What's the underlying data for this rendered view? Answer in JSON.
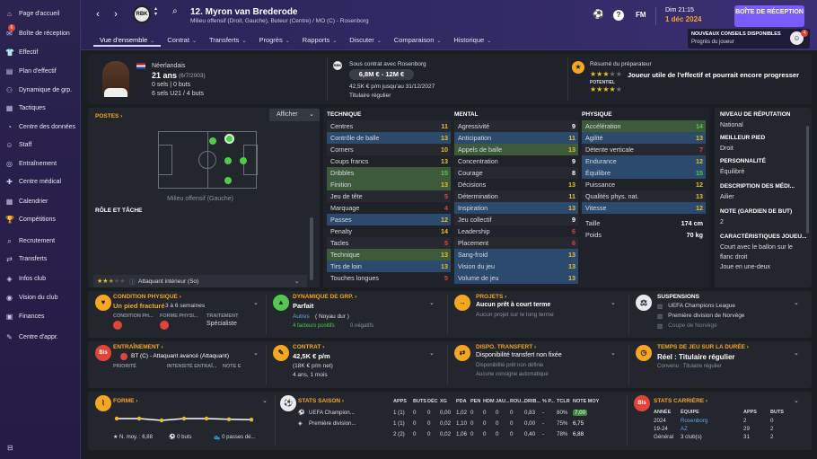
{
  "sidebar": {
    "items": [
      {
        "label": "Page d'accueil",
        "icon": "home-icon",
        "glyph": "⌂"
      },
      {
        "label": "Boîte de réception",
        "icon": "inbox-icon",
        "glyph": "✉",
        "badge": "6"
      },
      {
        "label": "Effectif",
        "icon": "squad-icon",
        "glyph": "👕"
      },
      {
        "label": "Plan d'effectif",
        "icon": "plan-icon",
        "glyph": "▤"
      },
      {
        "label": "Dynamique de grp.",
        "icon": "dynamics-icon",
        "glyph": "⚇"
      },
      {
        "label": "Tactiques",
        "icon": "tactics-icon",
        "glyph": "▦"
      },
      {
        "label": "Centre des données",
        "icon": "data-icon",
        "glyph": "◔"
      },
      {
        "label": "Staff",
        "icon": "staff-icon",
        "glyph": "☺"
      },
      {
        "label": "Entraînement",
        "icon": "training-icon",
        "glyph": "◎"
      },
      {
        "label": "Centre médical",
        "icon": "medical-icon",
        "glyph": "✚"
      },
      {
        "label": "Calendrier",
        "icon": "calendar-icon",
        "glyph": "▦"
      },
      {
        "label": "Compétitions",
        "icon": "trophy-icon",
        "glyph": "🏆"
      },
      {
        "label": "Recrutement",
        "icon": "scouting-icon",
        "glyph": "⌕"
      },
      {
        "label": "Transferts",
        "icon": "transfers-icon",
        "glyph": "⇄"
      },
      {
        "label": "Infos club",
        "icon": "club-info-icon",
        "glyph": "◈"
      },
      {
        "label": "Vision du club",
        "icon": "vision-icon",
        "glyph": "◉"
      },
      {
        "label": "Finances",
        "icon": "finances-icon",
        "glyph": "▣"
      },
      {
        "label": "Centre d'appr.",
        "icon": "learning-icon",
        "glyph": "✎"
      }
    ]
  },
  "header": {
    "player_number_name": "12. Myron van Brederode",
    "position_line": "Milieu offensif (Droit, Gauche), Buteur (Centre) / MO (C) - Rosenborg",
    "time": "Dim 21:15",
    "date": "1 déc 2024",
    "continue_label": "BOÎTE DE RÉCEPTION",
    "fm_label": "FM",
    "news_title": "NOUVEAUX CONSEILS DISPONIBLES",
    "news_sub": "Progrès du joueur",
    "news_badge": "4",
    "club_badge": "RBK"
  },
  "tabs": [
    {
      "label": "Vue d'ensemble",
      "active": true
    },
    {
      "label": "Contrat"
    },
    {
      "label": "Transferts"
    },
    {
      "label": "Progrès"
    },
    {
      "label": "Rapports"
    },
    {
      "label": "Discuter"
    },
    {
      "label": "Comparaison"
    },
    {
      "label": "Historique"
    }
  ],
  "info": {
    "nationality": "Néerlandais",
    "age": "21 ans",
    "birth": "(6/7/2003)",
    "caps": "0 sels | 0 buts",
    "u21": "6 sels U21 / 4 buts",
    "contract_club": "Sous contrat avec Rosenborg",
    "value": "6,8M € - 12M €",
    "wage": "42,5K € p/m jusqu'au 31/12/2027",
    "status": "Titulaire régulier",
    "coach_summary_title": "Résumé du préparateur",
    "potential_label": "POTENTIEL",
    "coach_summary": "Joueur utile de l'effectif et pourrait encore progresser",
    "current_stars": 3.5,
    "potential_stars": 4.5
  },
  "positions": {
    "title": "POSTES",
    "show_button": "Afficher",
    "caption": "Milieu offensif (Gauche)",
    "role_title": "RÔLE ET TÂCHE",
    "roles": [
      {
        "label": "Attaquant intérieur (So)",
        "stars": 2.5
      },
      {
        "label": "Ailier (So)",
        "stars": 2.5
      },
      {
        "label": "Ailier intérieur (So)",
        "stars": 2.5
      },
      {
        "label": "Attaquant de soutien (At)",
        "stars": 2.5
      }
    ]
  },
  "technique": {
    "title": "TECHNIQUE",
    "attrs": [
      {
        "name": "Centres",
        "val": "11",
        "hl": "",
        "col": "yellow"
      },
      {
        "name": "Contrôle de balle",
        "val": "13",
        "hl": "blue",
        "col": "yellow"
      },
      {
        "name": "Corners",
        "val": "10",
        "hl": "",
        "col": "yellow"
      },
      {
        "name": "Coups francs",
        "val": "13",
        "hl": "",
        "col": "yellow"
      },
      {
        "name": "Dribbles",
        "val": "15",
        "hl": "green",
        "col": "green"
      },
      {
        "name": "Finition",
        "val": "13",
        "hl": "green",
        "col": "yellow"
      },
      {
        "name": "Jeu de tête",
        "val": "5",
        "hl": "",
        "col": "red"
      },
      {
        "name": "Marquage",
        "val": "4",
        "hl": "",
        "col": "red"
      },
      {
        "name": "Passes",
        "val": "12",
        "hl": "blue",
        "col": "yellow"
      },
      {
        "name": "Penalty",
        "val": "14",
        "hl": "",
        "col": "yellow"
      },
      {
        "name": "Tacles",
        "val": "5",
        "hl": "",
        "col": "red"
      },
      {
        "name": "Technique",
        "val": "13",
        "hl": "green",
        "col": "yellow"
      },
      {
        "name": "Tirs de loin",
        "val": "13",
        "hl": "blue",
        "col": "yellow"
      },
      {
        "name": "Touches longues",
        "val": "5",
        "hl": "",
        "col": "red"
      }
    ]
  },
  "mental": {
    "title": "MENTAL",
    "attrs": [
      {
        "name": "Agressivité",
        "val": "9",
        "hl": "",
        "col": "white"
      },
      {
        "name": "Anticipation",
        "val": "11",
        "hl": "blue",
        "col": "yellow"
      },
      {
        "name": "Appels de balle",
        "val": "13",
        "hl": "green",
        "col": "yellow"
      },
      {
        "name": "Concentration",
        "val": "9",
        "hl": "",
        "col": "white"
      },
      {
        "name": "Courage",
        "val": "8",
        "hl": "",
        "col": "white"
      },
      {
        "name": "Décisions",
        "val": "13",
        "hl": "",
        "col": "yellow"
      },
      {
        "name": "Détermination",
        "val": "11",
        "hl": "",
        "col": "yellow"
      },
      {
        "name": "Inspiration",
        "val": "13",
        "hl": "blue",
        "col": "yellow"
      },
      {
        "name": "Jeu collectif",
        "val": "9",
        "hl": "",
        "col": "white"
      },
      {
        "name": "Leadership",
        "val": "6",
        "hl": "",
        "col": "red"
      },
      {
        "name": "Placement",
        "val": "6",
        "hl": "",
        "col": "red"
      },
      {
        "name": "Sang-froid",
        "val": "13",
        "hl": "blue",
        "col": "yellow"
      },
      {
        "name": "Vision du jeu",
        "val": "13",
        "hl": "blue",
        "col": "yellow"
      },
      {
        "name": "Volume de jeu",
        "val": "13",
        "hl": "blue",
        "col": "yellow"
      }
    ]
  },
  "physique": {
    "title": "PHYSIQUE",
    "attrs": [
      {
        "name": "Accélération",
        "val": "14",
        "hl": "green",
        "col": "green"
      },
      {
        "name": "Agilité",
        "val": "13",
        "hl": "blue",
        "col": "yellow"
      },
      {
        "name": "Détente verticale",
        "val": "7",
        "hl": "",
        "col": "red"
      },
      {
        "name": "Endurance",
        "val": "12",
        "hl": "blue",
        "col": "yellow"
      },
      {
        "name": "Équilibre",
        "val": "15",
        "hl": "blue",
        "col": "green"
      },
      {
        "name": "Puissance",
        "val": "12",
        "hl": "",
        "col": "yellow"
      },
      {
        "name": "Qualités phys. nat.",
        "val": "13",
        "hl": "",
        "col": "yellow"
      },
      {
        "name": "Vitesse",
        "val": "12",
        "hl": "blue",
        "col": "yellow"
      }
    ],
    "height_label": "Taille",
    "height": "174 cm",
    "weight_label": "Poids",
    "weight": "70 kg"
  },
  "side_info": [
    {
      "title": "NIVEAU DE RÉPUTATION",
      "value": "National"
    },
    {
      "title": "MEILLEUR PIED",
      "value": "Droit"
    },
    {
      "title": "PERSONNALITÉ",
      "value": "Équilibré"
    },
    {
      "title": "DESCRIPTION DES MÉDI...",
      "value": "Ailier"
    },
    {
      "title": "NOTE (GARDIEN DE BUT)",
      "value": "2"
    },
    {
      "title": "CARACTÉRISTIQUES JOUEU...",
      "value": "Court avec le ballon sur le flanc droit\nJoue en une-deux"
    }
  ],
  "cards_row1": {
    "condition": {
      "title": "CONDITION PHYSIQUE",
      "main": "Un pied fracturé",
      "weeks": "3 à 6 semaines",
      "col1": "CONDITION PH...",
      "col2": "FORME PHYSI...",
      "col3": "TRAITEMENT",
      "col3_val": "Spécialiste"
    },
    "dynamics": {
      "title": "DYNAMIQUE DE GRP.",
      "main": "Parfait",
      "sub": "Autres",
      "sub2": "( Noyau dur )",
      "pos": "4 facteurs positifs",
      "neg": "0 négatifs"
    },
    "projects": {
      "title": "PROJETS",
      "main": "Aucun prêt à court terme",
      "sub": "Aucun projet sur le long terme"
    },
    "suspensions": {
      "title": "SUSPENSIONS",
      "items": [
        "UEFA Champions League",
        "Première division de Norvège",
        "Coupe de Norvège"
      ]
    }
  },
  "cards_row2": {
    "training": {
      "title": "ENTRAÎNEMENT",
      "main": "BT (C) - Attaquant avancé (Attaquant)",
      "col1": "PRIORITÉ",
      "col2": "INTENSITÉ ENTRAÎ...",
      "col3": "NOTE E",
      "badge": "Bls"
    },
    "contract": {
      "title": "CONTRAT",
      "main": "42,5K € p/m",
      "sub": "(18K € p/m net)",
      "sub2": "4 ans, 1 mois"
    },
    "transfer": {
      "title": "DISPO. TRANSFERT",
      "main": "Disponibilité transfert non fixée",
      "sub": "Disponibilité prêt non définie",
      "sub2": "Aucune consigne automatique"
    },
    "playtime": {
      "title": "TEMPS DE JEU SUR LA DURÉE",
      "main": "Réel : Titulaire régulier",
      "sub": "Convenu : Titulaire régulier"
    }
  },
  "form": {
    "title": "FORME",
    "avg": "N. moy. : 6,88",
    "goals": "0 buts",
    "passes": "0 passes dé...",
    "points": [
      6.9,
      6.9,
      6.85,
      6.9,
      6.9,
      6.88,
      6.87
    ]
  },
  "season": {
    "title": "STATS SAISON",
    "headers": [
      "APPS",
      "BUTS",
      "DÉC",
      "XG",
      "PDA",
      "PEN",
      "HDM",
      "JAU...",
      "ROU...",
      "DRIB...",
      "% P...",
      "TCLR",
      "NOTE MOY"
    ],
    "rows": [
      {
        "comp": "UEFA Champion...",
        "vals": [
          "1 (1)",
          "0",
          "0",
          "0,00",
          "1,02",
          "0",
          "0",
          "0",
          "0",
          "0,83",
          "-",
          "80%",
          "7,00"
        ]
      },
      {
        "comp": "Première division...",
        "vals": [
          "1 (1)",
          "0",
          "0",
          "0,02",
          "1,10",
          "0",
          "0",
          "0",
          "0",
          "0,00",
          "-",
          "75%",
          "6,75"
        ]
      },
      {
        "comp": "",
        "vals": [
          "2 (2)",
          "0",
          "0",
          "0,02",
          "1,06",
          "0",
          "0",
          "0",
          "0",
          "0,40",
          "-",
          "78%",
          "6,88"
        ]
      }
    ]
  },
  "career": {
    "title": "STATS CARRIÈRE",
    "headers": [
      "ANNÉE",
      "ÉQUIPE",
      "APPS",
      "BUTS"
    ],
    "rows": [
      {
        "year": "2024",
        "team": "Rosenborg",
        "apps": "2",
        "goals": "0"
      },
      {
        "year": "19-24",
        "team": "AZ",
        "apps": "29",
        "goals": "2"
      },
      {
        "year": "Général",
        "team": "3 club(s)",
        "apps": "31",
        "goals": "2"
      }
    ]
  },
  "colors": {
    "accent": "#7a5cff",
    "orange": "#f5a623",
    "green": "#54c84e",
    "yellow": "#e6c02c",
    "red": "#e0453a",
    "panel": "#23262d",
    "sidebar": "#2b2350"
  }
}
